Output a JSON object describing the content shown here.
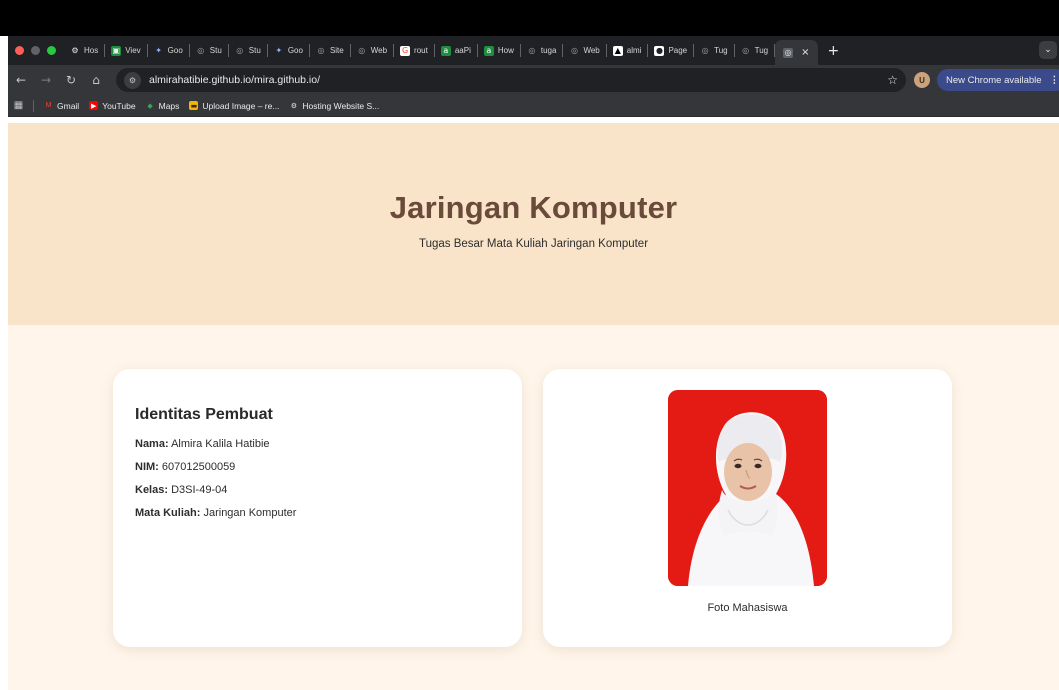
{
  "browser": {
    "tabs": [
      {
        "label": "Hos",
        "icon": "hosting-icon"
      },
      {
        "label": "Viev",
        "icon": "sheet-icon"
      },
      {
        "label": "Goo",
        "icon": "gemini-icon"
      },
      {
        "label": "Stu",
        "icon": "globe-icon"
      },
      {
        "label": "Stu",
        "icon": "globe-icon"
      },
      {
        "label": "Goo",
        "icon": "gemini-icon"
      },
      {
        "label": "Site",
        "icon": "globe-icon"
      },
      {
        "label": "Web",
        "icon": "globe-icon"
      },
      {
        "label": "rout",
        "icon": "google-icon"
      },
      {
        "label": "aaPi",
        "icon": "aa-icon"
      },
      {
        "label": "How",
        "icon": "aa-icon"
      },
      {
        "label": "tuga",
        "icon": "globe-icon"
      },
      {
        "label": "Web",
        "icon": "globe-icon"
      },
      {
        "label": "almi",
        "icon": "vercel-icon"
      },
      {
        "label": "Page",
        "icon": "github-icon"
      },
      {
        "label": "Tug",
        "icon": "globe-icon"
      },
      {
        "label": "Tug",
        "icon": "globe-icon"
      }
    ],
    "active_tab_close": "×",
    "new_tab": "+",
    "url": "almirahatibie.github.io/mira.github.io/",
    "update_label": "New Chrome available",
    "update_menu": "⋮",
    "profile_initial": "U",
    "bookmarks": [
      {
        "label": "Gmail",
        "icon": "gmail-icon"
      },
      {
        "label": "YouTube",
        "icon": "youtube-icon"
      },
      {
        "label": "Maps",
        "icon": "maps-icon"
      },
      {
        "label": "Upload Image – re...",
        "icon": "upload-icon"
      },
      {
        "label": "Hosting Website S...",
        "icon": "hosting-icon"
      }
    ]
  },
  "page": {
    "title": "Jaringan Komputer",
    "subtitle": "Tugas Besar Mata Kuliah Jaringan Komputer",
    "identity": {
      "heading": "Identitas Pembuat",
      "rows": [
        {
          "label": "Nama:",
          "value": "Almira Kalila Hatibie"
        },
        {
          "label": "NIM:",
          "value": "607012500059"
        },
        {
          "label": "Kelas:",
          "value": "D3SI-49-04"
        },
        {
          "label": "Mata Kuliah:",
          "value": "Jaringan Komputer"
        }
      ]
    },
    "photo_caption": "Foto Mahasiswa"
  },
  "colors": {
    "hero_bg": "#f9e4ca",
    "page_bg": "#fff5ea",
    "title": "#6a4a3a",
    "photo_bg": "#e31b14"
  }
}
